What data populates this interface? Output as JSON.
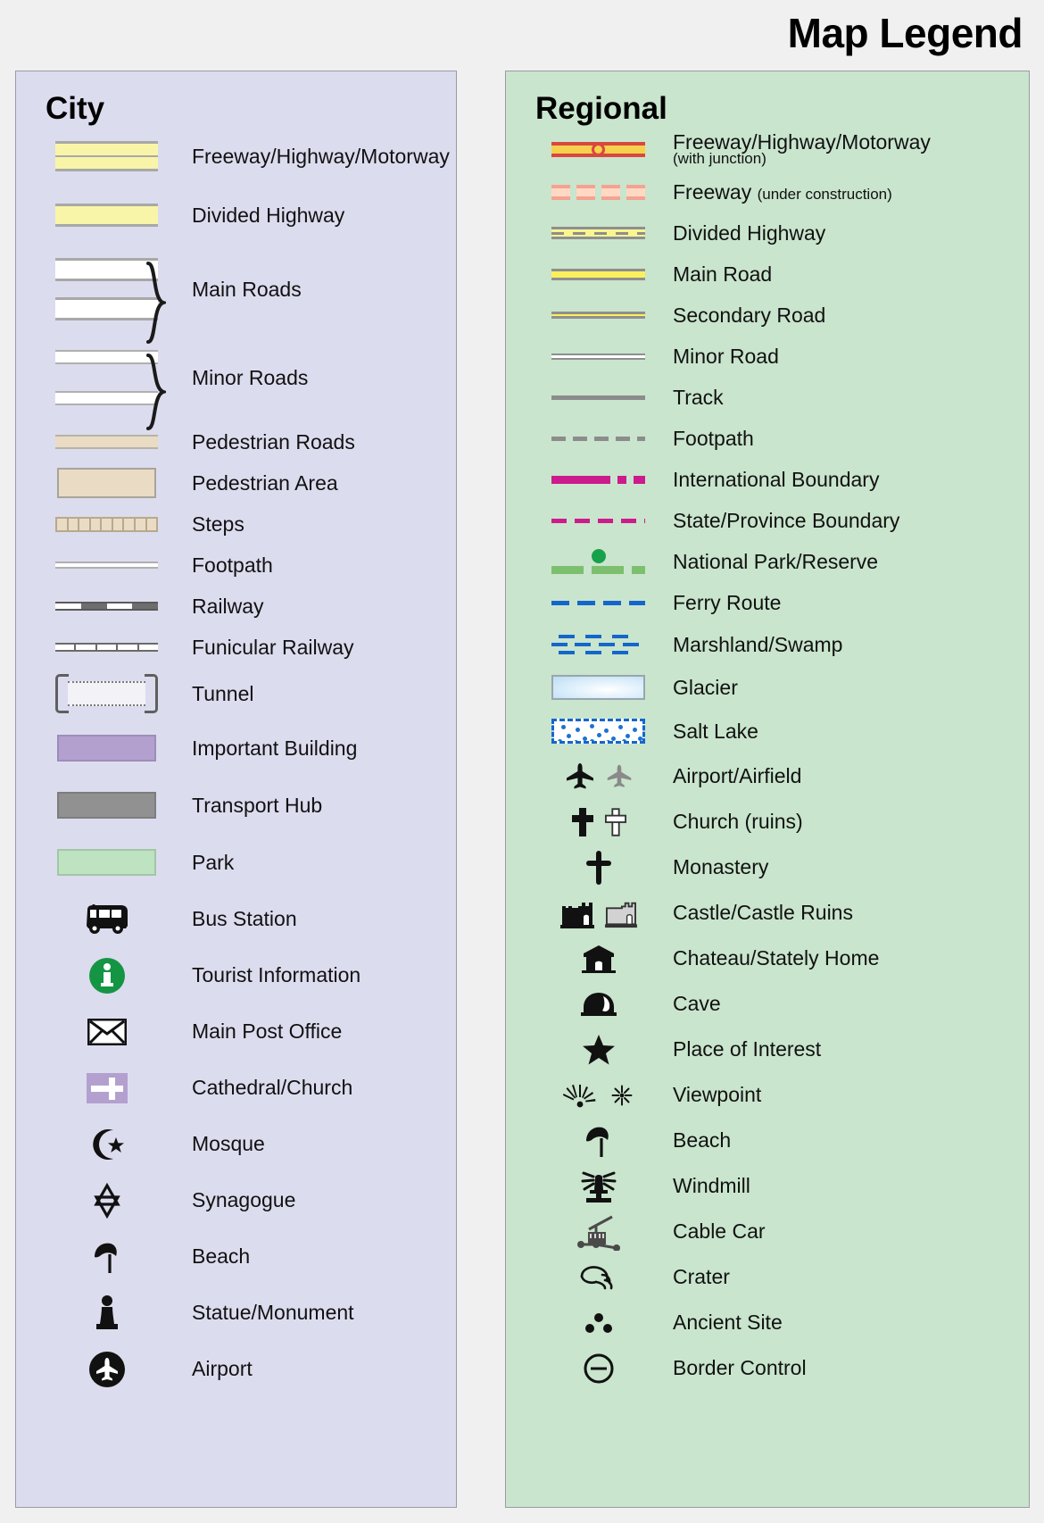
{
  "title": "Map Legend",
  "panels": {
    "city": {
      "heading": "City",
      "items": [
        {
          "label": "Freeway/Highway/Motorway",
          "symbol": "city-freeway"
        },
        {
          "label": "Divided Highway",
          "symbol": "city-divided-highway"
        },
        {
          "label": "Main Roads",
          "symbol": "city-main-roads-braced"
        },
        {
          "label": "Minor Roads",
          "symbol": "city-minor-roads-braced"
        },
        {
          "label": "Pedestrian Roads",
          "symbol": "city-pedestrian-road"
        },
        {
          "label": "Pedestrian Area",
          "symbol": "city-pedestrian-area"
        },
        {
          "label": "Steps",
          "symbol": "city-steps"
        },
        {
          "label": "Footpath",
          "symbol": "city-footpath"
        },
        {
          "label": "Railway",
          "symbol": "city-railway"
        },
        {
          "label": "Funicular Railway",
          "symbol": "city-funicular-railway"
        },
        {
          "label": "Tunnel",
          "symbol": "city-tunnel"
        },
        {
          "label": "Important Building",
          "symbol": "city-important-building"
        },
        {
          "label": "Transport Hub",
          "symbol": "city-transport-hub"
        },
        {
          "label": "Park",
          "symbol": "city-park"
        },
        {
          "label": "Bus Station",
          "symbol": "bus-icon"
        },
        {
          "label": "Tourist Information",
          "symbol": "information-icon"
        },
        {
          "label": "Main Post Office",
          "symbol": "envelope-icon"
        },
        {
          "label": "Cathedral/Church",
          "symbol": "cathedral-cross-icon"
        },
        {
          "label": "Mosque",
          "symbol": "crescent-star-icon"
        },
        {
          "label": "Synagogue",
          "symbol": "star-of-david-icon"
        },
        {
          "label": "Beach",
          "symbol": "beach-umbrella-icon"
        },
        {
          "label": "Statue/Monument",
          "symbol": "statue-icon"
        },
        {
          "label": "Airport",
          "symbol": "airport-circle-icon"
        }
      ]
    },
    "regional": {
      "heading": "Regional",
      "items": [
        {
          "label": "Freeway/Highway/Motorway",
          "sub": "(with junction)",
          "sub_block": true,
          "symbol": "regional-freeway-junction"
        },
        {
          "label": "Freeway",
          "sub": "(under construction)",
          "sub_block": false,
          "symbol": "regional-freeway-under-construction"
        },
        {
          "label": "Divided Highway",
          "symbol": "regional-divided-highway"
        },
        {
          "label": "Main Road",
          "symbol": "regional-main-road"
        },
        {
          "label": "Secondary Road",
          "symbol": "regional-secondary-road"
        },
        {
          "label": "Minor Road",
          "symbol": "regional-minor-road"
        },
        {
          "label": "Track",
          "symbol": "regional-track"
        },
        {
          "label": "Footpath",
          "symbol": "regional-footpath"
        },
        {
          "label": "International Boundary",
          "symbol": "regional-international-boundary"
        },
        {
          "label": "State/Province Boundary",
          "symbol": "regional-state-boundary"
        },
        {
          "label": "National Park/Reserve",
          "symbol": "regional-national-park"
        },
        {
          "label": "Ferry Route",
          "symbol": "regional-ferry-route"
        },
        {
          "label": "Marshland/Swamp",
          "symbol": "regional-marshland"
        },
        {
          "label": "Glacier",
          "symbol": "regional-glacier"
        },
        {
          "label": "Salt Lake",
          "symbol": "regional-salt-lake"
        },
        {
          "label": "Airport/Airfield",
          "symbol": "airplane-pair-icon"
        },
        {
          "label": "Church (ruins)",
          "symbol": "church-ruins-cross-icon"
        },
        {
          "label": "Monastery",
          "symbol": "monastery-cross-icon"
        },
        {
          "label": "Castle/Castle Ruins",
          "symbol": "castle-pair-icon"
        },
        {
          "label": "Chateau/Stately Home",
          "symbol": "chateau-icon"
        },
        {
          "label": "Cave",
          "symbol": "cave-icon"
        },
        {
          "label": "Place of Interest",
          "symbol": "star-icon"
        },
        {
          "label": "Viewpoint",
          "symbol": "viewpoint-pair-icon"
        },
        {
          "label": "Beach",
          "symbol": "beach-umbrella-icon"
        },
        {
          "label": "Windmill",
          "symbol": "windmill-icon"
        },
        {
          "label": "Cable Car",
          "symbol": "cable-car-icon"
        },
        {
          "label": "Crater",
          "symbol": "crater-icon"
        },
        {
          "label": "Ancient Site",
          "symbol": "ancient-site-icon"
        },
        {
          "label": "Border Control",
          "symbol": "border-control-icon"
        }
      ]
    }
  },
  "colors": {
    "page_background": "#f0f0f0",
    "city_panel": "#dcdcef",
    "regional_panel": "#c9e5cd",
    "panel_border": "#9a9aa8",
    "highway_yellow": "#f9f5a8",
    "regional_road_yellow": "#fbf05c",
    "freeway_red": "#d9483f",
    "freeway_fill": "#f5d14e",
    "under_construction": "#f5a391",
    "pedestrian_tan": "#eadcc4",
    "important_building": "#b3a0cf",
    "transport_hub": "#919191",
    "park_green": "#bde3c0",
    "boundary_magenta": "#cc1b8d",
    "national_park_green": "#7cbf6e",
    "national_park_dot": "#17a14a",
    "water_blue": "#1566cc",
    "information_green": "#149544",
    "road_grey": "#8f8f8f"
  }
}
